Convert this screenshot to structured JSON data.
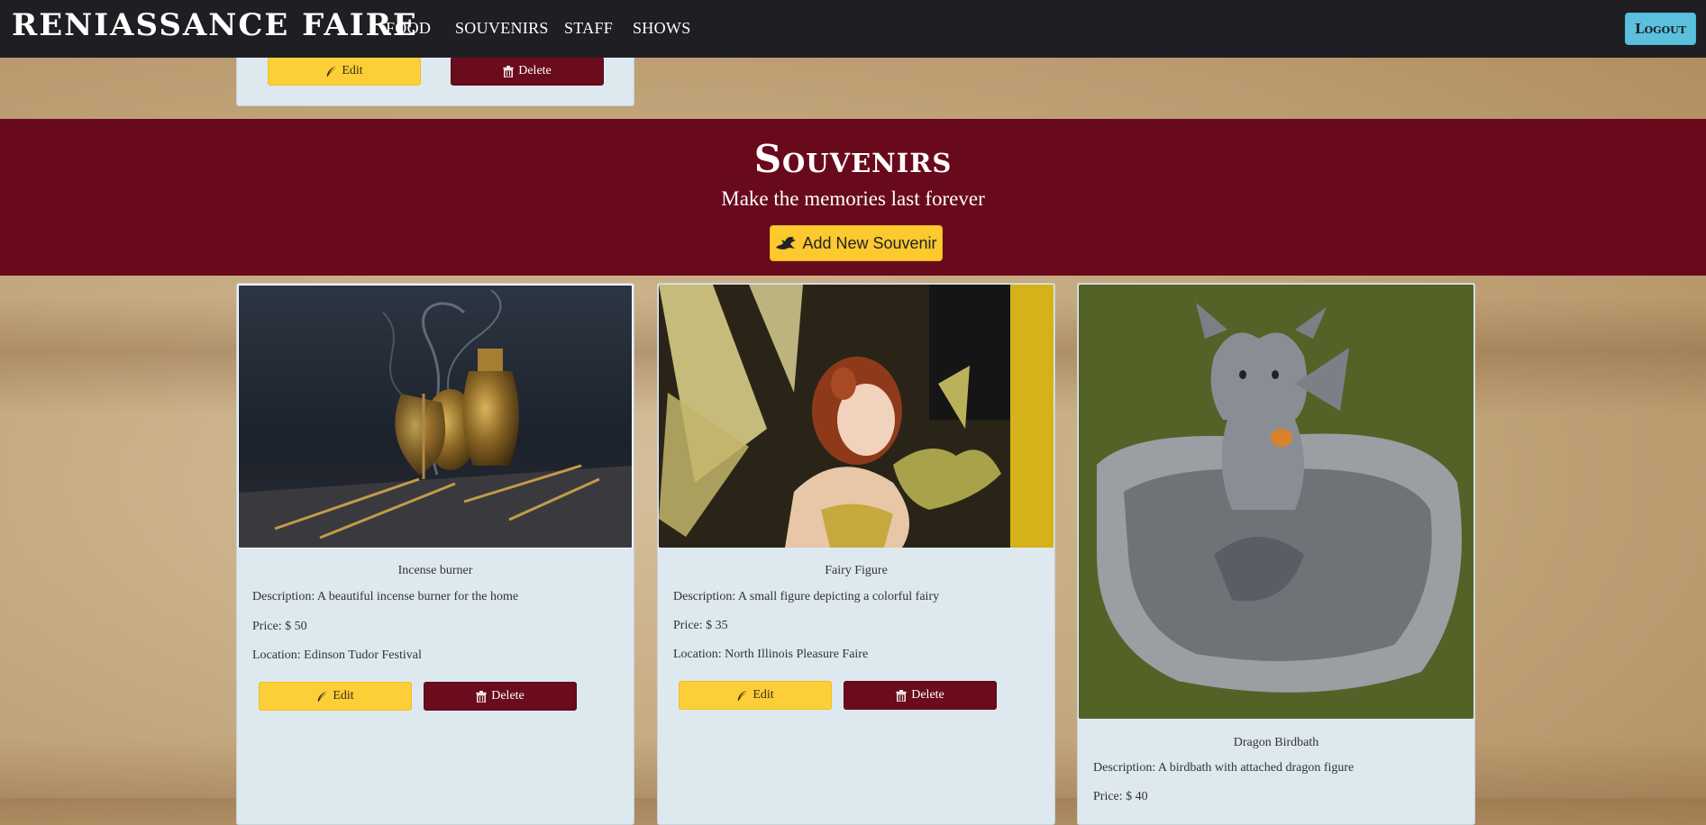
{
  "navbar": {
    "brand": "RENIASSANCE FAIRE",
    "links": [
      "FOOD",
      "SOUVENIRS",
      "STAFF",
      "SHOWS"
    ],
    "logout_label": "Logout"
  },
  "top_card": {
    "edit_label": "Edit",
    "delete_label": "Delete"
  },
  "banner": {
    "title": "Souvenirs",
    "subtitle": "Make the memories last forever",
    "add_button_label": "Add New Souvenir"
  },
  "cards": [
    {
      "title": "Incense burner",
      "description": "Description: A beautiful incense burner for the home",
      "price": "Price: $ 50",
      "location": "Location: Edinson Tudor Festival",
      "edit_label": "Edit",
      "delete_label": "Delete"
    },
    {
      "title": "Fairy Figure",
      "description": "Description: A small figure depicting a colorful fairy",
      "price": "Price: $ 35",
      "location": "Location: North Illinois Pleasure Faire",
      "edit_label": "Edit",
      "delete_label": "Delete"
    },
    {
      "title": "Dragon Birdbath",
      "description": "Description: A birdbath with attached dragon figure",
      "price": "Price: $ 40"
    }
  ],
  "colors": {
    "navbar": "#1f1e23",
    "banner": "#690a1c",
    "accent_yellow": "#fcce37",
    "delete_red": "#6a0c1c",
    "logout_blue": "#5bc0de",
    "card_bg": "#dde8ef"
  },
  "icons": {
    "edit": "feather-icon",
    "delete": "trash-icon",
    "add": "dragon-icon"
  }
}
